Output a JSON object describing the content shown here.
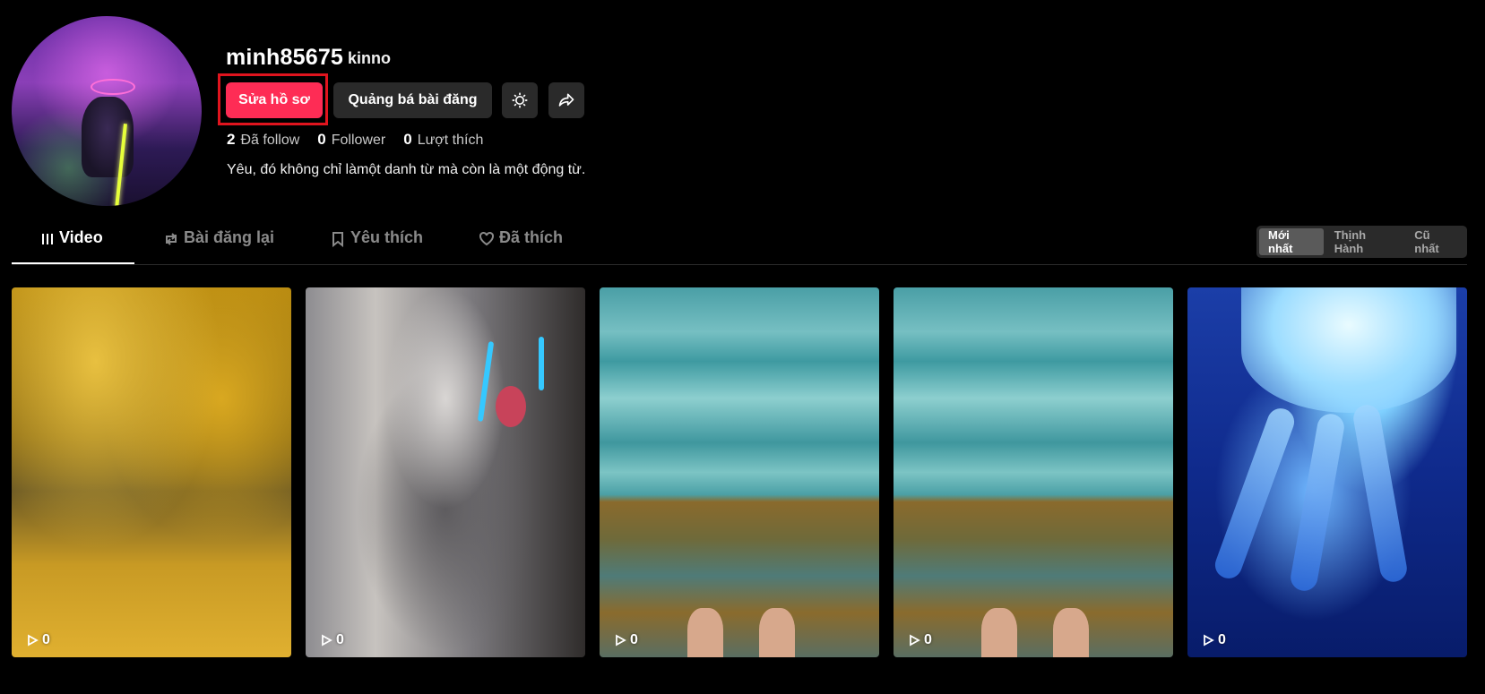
{
  "profile": {
    "username": "minh85675",
    "nickname": "kinno",
    "bio": "Yêu, đó không chỉ làmột danh từ mà còn là một động từ."
  },
  "actions": {
    "edit_profile": "Sửa hồ sơ",
    "promote_post": "Quảng bá bài đăng",
    "settings_icon": "gear-icon",
    "share_icon": "share-icon"
  },
  "stats": [
    {
      "value": "2",
      "label": "Đã follow"
    },
    {
      "value": "0",
      "label": "Follower"
    },
    {
      "value": "0",
      "label": "Lượt thích"
    }
  ],
  "tabs": [
    {
      "label": "Video",
      "icon": "grid-bars-icon",
      "active": true
    },
    {
      "label": "Bài đăng lại",
      "icon": "repost-icon",
      "active": false
    },
    {
      "label": "Yêu thích",
      "icon": "bookmark-icon",
      "active": false
    },
    {
      "label": "Đã thích",
      "icon": "heart-icon",
      "active": false
    }
  ],
  "sort": {
    "options": [
      "Mới nhất",
      "Thịnh Hành",
      "Cũ nhất"
    ],
    "selected": "Mới nhất"
  },
  "videos": [
    {
      "plays": "0",
      "scene": "autumn"
    },
    {
      "plays": "0",
      "scene": "cat"
    },
    {
      "plays": "0",
      "scene": "sea"
    },
    {
      "plays": "0",
      "scene": "sea"
    },
    {
      "plays": "0",
      "scene": "jellyfish"
    }
  ],
  "colors": {
    "accent": "#fe2c55",
    "highlight_border": "#e0141e",
    "button_dark": "#2a2a2a"
  }
}
